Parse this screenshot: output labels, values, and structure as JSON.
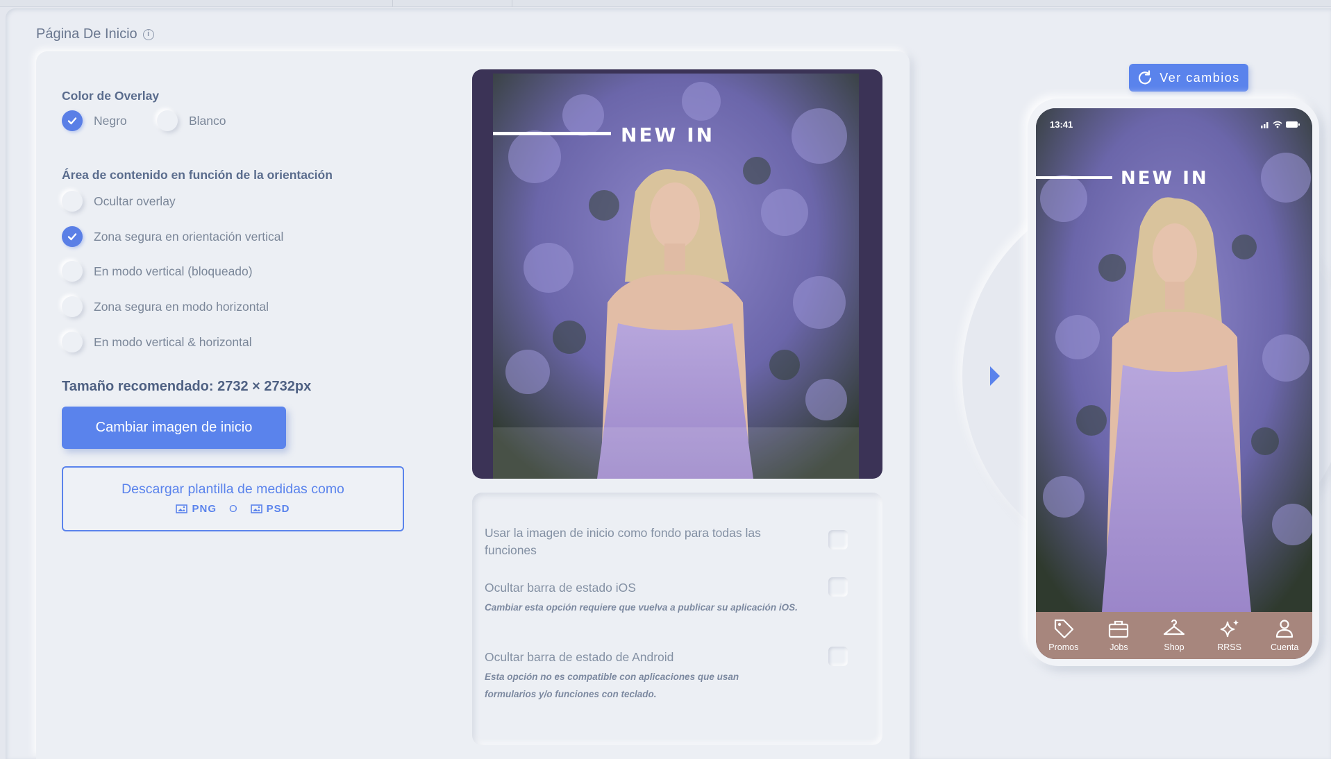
{
  "page": {
    "title": "Página De Inicio",
    "info_icon": "info-icon"
  },
  "overlay_color": {
    "label": "Color de Overlay",
    "options": [
      {
        "label": "Negro",
        "selected": true
      },
      {
        "label": "Blanco",
        "selected": false
      }
    ]
  },
  "content_area": {
    "label": "Área de contenido en función de la orientación",
    "options": [
      {
        "label": "Ocultar overlay",
        "selected": false
      },
      {
        "label": "Zona segura en orientación vertical",
        "selected": true
      },
      {
        "label": "En modo vertical (bloqueado)",
        "selected": false
      },
      {
        "label": "Zona segura en modo horizontal",
        "selected": false
      },
      {
        "label": "En modo vertical & horizontal",
        "selected": false
      }
    ]
  },
  "recommended_size": "Tamaño recomendado: 2732 × 2732px",
  "change_image_button": "Cambiar imagen de inicio",
  "download_template": {
    "line1": "Descargar plantilla de medidas como",
    "png": "PNG",
    "separator": "O",
    "psd": "PSD"
  },
  "preview": {
    "overlay_text": "NEW IN"
  },
  "options": [
    {
      "label": "Usar la imagen de inicio como fondo para todas las funciones",
      "note": "",
      "checked": false
    },
    {
      "label": "Ocultar barra de estado iOS",
      "note": "Cambiar esta opción requiere que vuelva a publicar su aplicación iOS.",
      "checked": false
    },
    {
      "label": "Ocultar barra de estado de Android",
      "note": "Esta opción no es compatible con aplicaciones que usan formularios y/o funciones con teclado.",
      "checked": false
    }
  ],
  "ver_cambios": {
    "label": "Ver cambios",
    "icon": "refresh-icon"
  },
  "phone": {
    "time": "13:41",
    "overlay_text": "NEW IN",
    "tabbar_color": "#a7867d",
    "tabs": [
      {
        "label": "Promos",
        "icon": "tag-icon"
      },
      {
        "label": "Jobs",
        "icon": "briefcase-icon"
      },
      {
        "label": "Shop",
        "icon": "hanger-icon"
      },
      {
        "label": "RRSS",
        "icon": "sparkle-icon"
      },
      {
        "label": "Cuenta",
        "icon": "user-icon"
      }
    ]
  },
  "colors": {
    "accent": "#5a83ec",
    "preview_frame": "#3b3356"
  }
}
